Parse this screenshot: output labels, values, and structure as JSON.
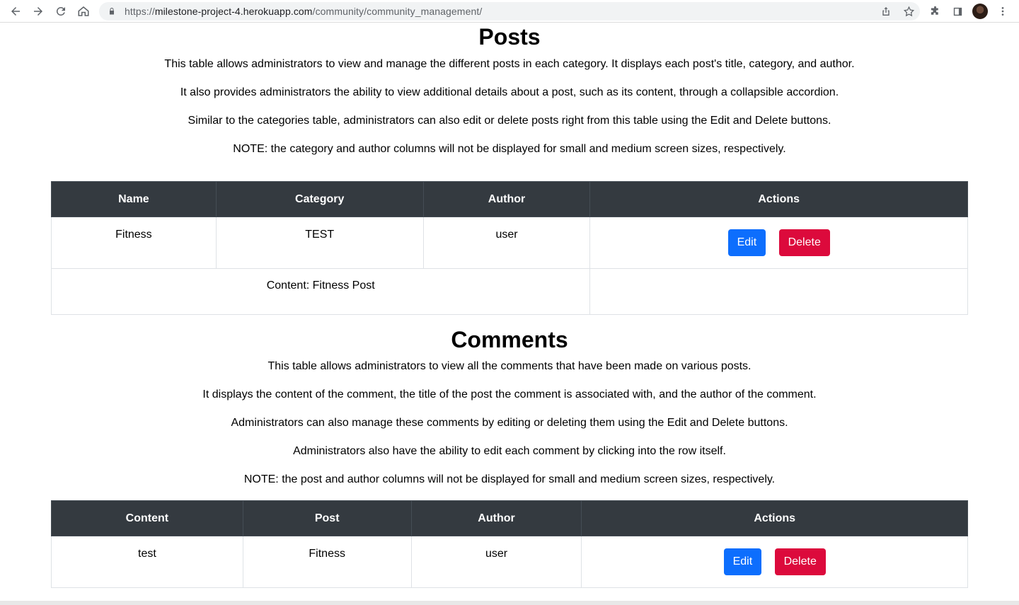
{
  "browser": {
    "url_scheme": "https://",
    "url_host": "milestone-project-4.herokuapp.com",
    "url_path": "/community/community_management/"
  },
  "posts": {
    "title": "Posts",
    "descriptions": [
      "This table allows administrators to view and manage the different posts in each category. It displays each post's title, category, and author.",
      "It also provides administrators the ability to view additional details about a post, such as its content, through a collapsible accordion.",
      "Similar to the categories table, administrators can also edit or delete posts right from this table using the Edit and Delete buttons.",
      "NOTE: the category and author columns will not be displayed for small and medium screen sizes, respectively."
    ],
    "headers": [
      "Name",
      "Category",
      "Author",
      "Actions"
    ],
    "rows": [
      {
        "name": "Fitness",
        "category": "TEST",
        "author": "user",
        "edit": "Edit",
        "delete": "Delete",
        "content": "Content: Fitness Post"
      }
    ]
  },
  "comments": {
    "title": "Comments",
    "descriptions": [
      "This table allows administrators to view all the comments that have been made on various posts.",
      "It displays the content of the comment, the title of the post the comment is associated with, and the author of the comment.",
      "Administrators can also manage these comments by editing or deleting them using the Edit and Delete buttons.",
      "Administrators also have the ability to edit each comment by clicking into the row itself.",
      "NOTE: the post and author columns will not be displayed for small and medium screen sizes, respectively."
    ],
    "headers": [
      "Content",
      "Post",
      "Author",
      "Actions"
    ],
    "rows": [
      {
        "content": "test",
        "post": "Fitness",
        "author": "user",
        "edit": "Edit",
        "delete": "Delete"
      }
    ]
  },
  "colors": {
    "header_bg": "#343a40",
    "edit_button": "#0d6efd",
    "delete_button": "#dc0a3c"
  }
}
